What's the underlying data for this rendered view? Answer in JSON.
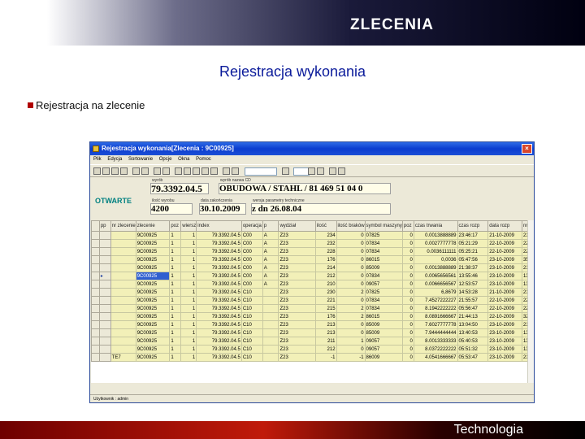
{
  "slide": {
    "title": "ZLECENIA",
    "subtitle": "Rejestracja wykonania",
    "bullet": "Rejestracja na zlecenie",
    "footer": "Technologia"
  },
  "window": {
    "title": "Rejestracja wykonania[Zlecenia : 9C00925]",
    "close_label": "×",
    "menu": [
      "Plik",
      "Edycja",
      "Sortowanie",
      "Opcje",
      "Okna",
      "Pomoc"
    ],
    "status_text": "OTWARTE",
    "statusbar": "Użytkownik : admin",
    "fields": {
      "wyrob_label": "wyrób",
      "wyrob_value": "79.3392.04.5",
      "nazwa_label": "wyrób nazwa CD",
      "nazwa_value": "OBUDOWA / STAHL / 81 469 51 04 0",
      "ilosc_label": "ilość wyrobu",
      "ilosc_value": "4200",
      "data_label": "data zakończenia",
      "data_value": "30.10.2009",
      "param_label": "wersja parametry techniczne",
      "param_value": "z dn 26.08.04"
    }
  },
  "grid": {
    "columns": [
      "",
      "pp",
      "nr zlecenie",
      "zlecenie",
      "poz",
      "wiersz",
      "index",
      "operacja",
      "p",
      "wydział",
      "ilość",
      "ilość braków",
      "symbol maszyny",
      "poz",
      "czas trwania",
      "czas rozp",
      "data rozp",
      "nr"
    ],
    "rows": [
      [
        "",
        "",
        "9C00925",
        "1",
        "1",
        "79.3392.04.5",
        "C00",
        "A",
        "Z23",
        "234",
        "0",
        "07825",
        "0",
        "0.0013888889",
        "23:46:17",
        "21-10-2009",
        "21"
      ],
      [
        "",
        "",
        "9C00925",
        "1",
        "1",
        "79.3392.04.5",
        "C00",
        "A",
        "Z23",
        "232",
        "0",
        "07834",
        "0",
        "0.0027777778",
        "05:21:29",
        "22-10-2009",
        "22"
      ],
      [
        "",
        "",
        "9C00925",
        "1",
        "1",
        "79.3392.04.5",
        "C00",
        "A",
        "Z23",
        "228",
        "0",
        "07834",
        "0",
        "0.0036111111",
        "05:25:21",
        "22-10-2009",
        "22"
      ],
      [
        "",
        "",
        "9C00925",
        "1",
        "1",
        "79.3392.04.5",
        "C00",
        "A",
        "Z23",
        "176",
        "0",
        "86015",
        "0",
        "0,0036",
        "05:47:56",
        "23-10-2009",
        "35"
      ],
      [
        "",
        "",
        "9C00925",
        "1",
        "1",
        "79.3392.04.5",
        "C00",
        "A",
        "Z23",
        "214",
        "0",
        "85009",
        "0",
        "0.0013888889",
        "21:38:37",
        "23-10-2009",
        "21"
      ],
      [
        "▸",
        "",
        "9C00925",
        "1",
        "1",
        "79.3392.04.5",
        "C00",
        "A",
        "Z23",
        "212",
        "0",
        "07834",
        "0",
        "0.0065656561",
        "13:55:46",
        "23-10-2009",
        "13"
      ],
      [
        "",
        "",
        "9C00925",
        "1",
        "1",
        "79.3392.04.5",
        "C00",
        "A",
        "Z23",
        "210",
        "0",
        "09057",
        "0",
        "0.0066656567",
        "12:53:57",
        "23-10-2009",
        "13"
      ],
      [
        "",
        "",
        "9C00925",
        "1",
        "1",
        "79.3392.04.5",
        "C10",
        "",
        "Z23",
        "230",
        "2",
        "07825",
        "0",
        "6,8679",
        "14:53:28",
        "21-10-2009",
        "21"
      ],
      [
        "",
        "",
        "9C00925",
        "1",
        "1",
        "79.3392.04.5",
        "C10",
        "",
        "Z23",
        "221",
        "0",
        "07834",
        "0",
        "7.4527222227",
        "21:55:57",
        "22-10-2009",
        "22"
      ],
      [
        "",
        "",
        "9C00925",
        "1",
        "1",
        "79.3392.04.5",
        "C10",
        "",
        "Z23",
        "215",
        "2",
        "07834",
        "0",
        "8.1942222222",
        "05:56:47",
        "22-10-2009",
        "22"
      ],
      [
        "",
        "",
        "9C00925",
        "1",
        "1",
        "79.3392.04.5",
        "C10",
        "",
        "Z23",
        "176",
        "2",
        "86015",
        "0",
        "8.0891666667",
        "21:44:13",
        "22-10-2009",
        "32"
      ],
      [
        "",
        "",
        "9C00925",
        "1",
        "1",
        "79.3392.04.5",
        "C10",
        "",
        "Z23",
        "213",
        "0",
        "85009",
        "0",
        "7.6027777778",
        "13:04:50",
        "23-10-2009",
        "21"
      ],
      [
        "",
        "",
        "9C00925",
        "1",
        "1",
        "79.3392.04.5",
        "C10",
        "",
        "Z23",
        "213",
        "0",
        "85009",
        "0",
        "7.9444444444",
        "13:40:53",
        "23-10-2009",
        "13"
      ],
      [
        "",
        "",
        "9C00925",
        "1",
        "1",
        "79.3392.04.5",
        "C10",
        "",
        "Z23",
        "211",
        "1",
        "09057",
        "0",
        "8.0013333333",
        "05:40:53",
        "23-10-2009",
        "13"
      ],
      [
        "",
        "",
        "9C00925",
        "1",
        "1",
        "79.3392.04.5",
        "C10",
        "",
        "Z23",
        "212",
        "0",
        "09057",
        "0",
        "8.0372222222",
        "05:51:32",
        "23-10-2009",
        "13"
      ],
      [
        "",
        "TE7",
        "9C00925",
        "1",
        "1",
        "79.3392.04.5",
        "C10",
        "",
        "Z23",
        "-1",
        "-1",
        "86009",
        "0",
        "4.0541666667",
        "05:53:47",
        "23-10-2009",
        "21"
      ]
    ]
  }
}
